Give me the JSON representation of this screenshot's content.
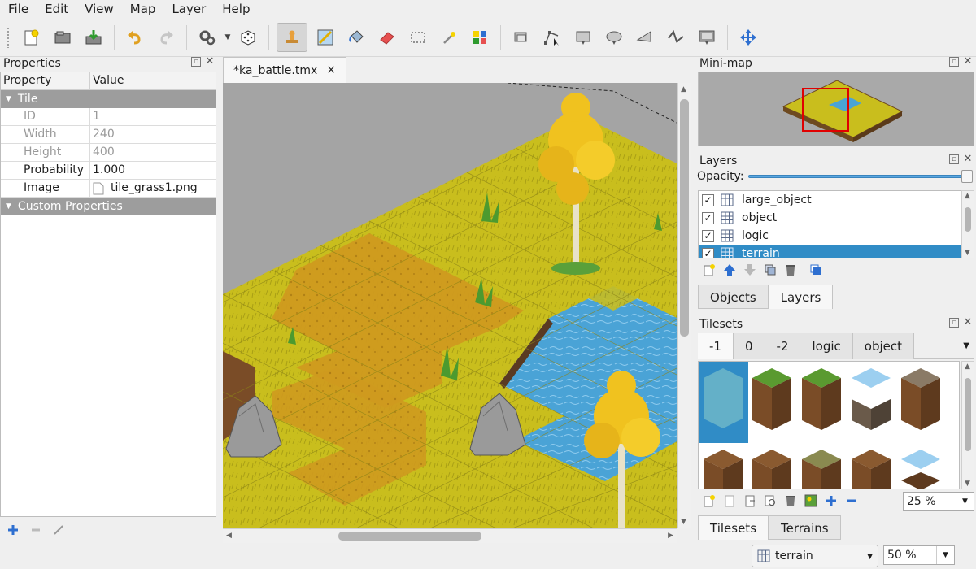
{
  "menu": [
    "File",
    "Edit",
    "View",
    "Map",
    "Layer",
    "Help"
  ],
  "toolbar": {
    "file_tools": [
      "new-map-icon",
      "open-icon",
      "save-icon"
    ],
    "history_tools": [
      "undo-icon",
      "redo-icon"
    ],
    "random_tools": [
      "command-icon",
      "dice-icon"
    ],
    "edit_tools": [
      "stamp-brush-icon",
      "terrain-brush-icon",
      "bucket-fill-icon",
      "eraser-icon",
      "rect-select-icon",
      "magic-wand-icon",
      "select-same-tile-icon"
    ],
    "object_tools": [
      "select-objects-icon",
      "edit-polygons-icon",
      "insert-rectangle-icon",
      "insert-ellipse-icon",
      "insert-polygon-icon",
      "insert-polyline-icon",
      "insert-tile-icon"
    ],
    "move_tool": "move-icon"
  },
  "properties": {
    "title": "Properties",
    "col_property": "Property",
    "col_value": "Value",
    "group_tile": "Tile",
    "rows": [
      {
        "key": "ID",
        "value": "1",
        "readonly": true
      },
      {
        "key": "Width",
        "value": "240",
        "readonly": true
      },
      {
        "key": "Height",
        "value": "400",
        "readonly": true
      },
      {
        "key": "Probability",
        "value": "1.000",
        "readonly": false
      },
      {
        "key": "Image",
        "value": "tile_grass1.png",
        "readonly": false
      }
    ],
    "group_custom": "Custom Properties"
  },
  "document": {
    "tab_title": "*ka_battle.tmx",
    "close": "×"
  },
  "minimap": {
    "title": "Mini-map"
  },
  "layers": {
    "title": "Layers",
    "opacity_label": "Opacity:",
    "opacity": 1.0,
    "items": [
      {
        "name": "large_object",
        "visible": true,
        "selected": false
      },
      {
        "name": "object",
        "visible": true,
        "selected": false
      },
      {
        "name": "logic",
        "visible": true,
        "selected": false
      },
      {
        "name": "terrain",
        "visible": true,
        "selected": true
      }
    ],
    "tabs": [
      "Objects",
      "Layers"
    ],
    "active_tab": "Layers"
  },
  "tilesets": {
    "title": "Tilesets",
    "tabs": [
      "-1",
      "0",
      "-2",
      "logic",
      "object"
    ],
    "active_tab": "-1",
    "zoom": "25 %",
    "bottom_tabs": [
      "Tilesets",
      "Terrains"
    ]
  },
  "status": {
    "current_layer": "terrain",
    "zoom": "50 %"
  },
  "colors": {
    "selection": "#308cc6",
    "grass": "#c9be1d",
    "dirt": "#cf9a1e",
    "water": "#4aa3d6"
  }
}
